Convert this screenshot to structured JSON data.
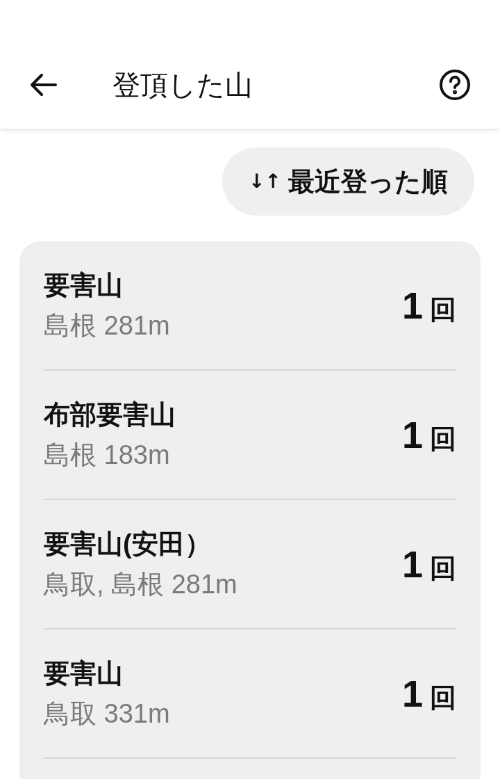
{
  "header": {
    "title": "登頂した山"
  },
  "sort_button": {
    "icon": "↓↑",
    "label": "最近登った順"
  },
  "mountains": [
    {
      "name": "要害山",
      "subtitle": "島根 281m",
      "count": "1",
      "unit": "回"
    },
    {
      "name": "布部要害山",
      "subtitle": "島根 183m",
      "count": "1",
      "unit": "回"
    },
    {
      "name": "要害山(安田）",
      "subtitle": "鳥取, 島根 281m",
      "count": "1",
      "unit": "回"
    },
    {
      "name": "要害山",
      "subtitle": "鳥取 331m",
      "count": "1",
      "unit": "回"
    }
  ]
}
